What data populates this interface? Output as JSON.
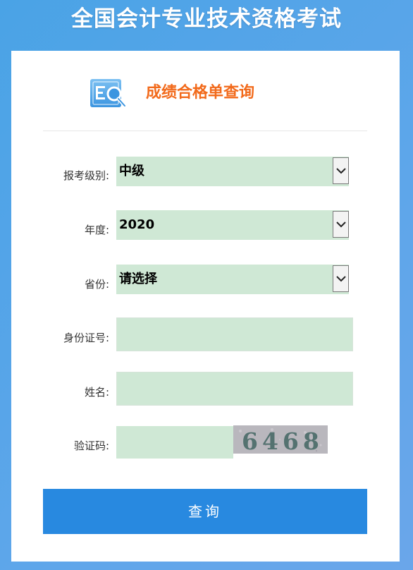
{
  "header": {
    "title": "全国会计专业技术资格考试"
  },
  "card": {
    "title": "成绩合格单查询",
    "logo_icon": "search-document-icon",
    "accent_color": "#f26a1b"
  },
  "form": {
    "level": {
      "label": "报考级别:",
      "value": "中级"
    },
    "year": {
      "label": "年度:",
      "value": "2020"
    },
    "province": {
      "label": "省份:",
      "value": "请选择"
    },
    "id_number": {
      "label": "身份证号:",
      "value": ""
    },
    "name": {
      "label": "姓名:",
      "value": ""
    },
    "captcha": {
      "label": "验证码:",
      "value": "",
      "code": "6468"
    },
    "submit_label": "查询"
  },
  "colors": {
    "background": "#4aa3e6",
    "input_fill": "#cfe8d5",
    "button": "#2889e0"
  }
}
